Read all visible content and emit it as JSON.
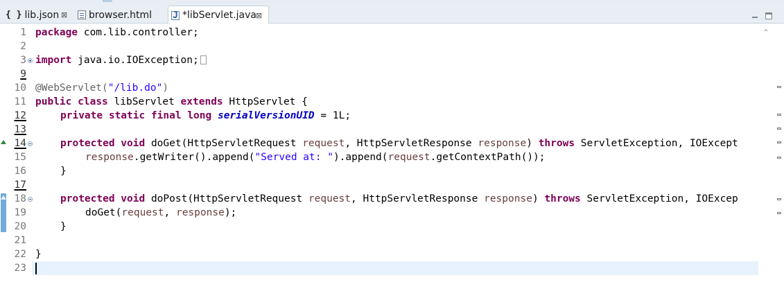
{
  "tabs": [
    {
      "label": "lib.json",
      "icon": "json-file-icon",
      "icon_glyph": "{ }"
    },
    {
      "label": "browser.html",
      "icon": "html-file-icon"
    },
    {
      "label": "*libServlet.java",
      "icon": "java-file-icon",
      "icon_glyph": "J",
      "active": true
    }
  ],
  "close_glyph": "⊠",
  "scroll_up_glyph": "⌃",
  "gutter": {
    "line_numbers": [
      "1",
      "2",
      "3",
      "9",
      "10",
      "11",
      "12",
      "13",
      "14",
      "15",
      "16",
      "17",
      "18",
      "19",
      "20",
      "21",
      "22",
      "23"
    ]
  },
  "code": {
    "line1_kw": "package",
    "line1_rest": " com.lib.controller;",
    "line3_kw": "import",
    "line3_rest": " java.io.IOException;",
    "line10_ann": "@WebServlet(",
    "line10_str": "\"/lib.do\"",
    "line10_end": ")",
    "line11_kw1": "public",
    "line11_kw2": "class",
    "line11_name": " libServlet ",
    "line11_kw3": "extends",
    "line11_rest": " HttpServlet {",
    "line12_kw": "private static final long",
    "line12_field": "serialVersionUID",
    "line12_rest": " = 1L;",
    "line14_kw1": "protected void",
    "line14_mid1": " doGet(HttpServletRequest ",
    "line14_p1": "request",
    "line14_mid2": ", HttpServletResponse ",
    "line14_p2": "response",
    "line14_mid3": ") ",
    "line14_kw2": "throws",
    "line14_rest": " ServletException, IOExcept",
    "line15_p1": "response",
    "line15_mid1": ".getWriter().append(",
    "line15_str": "\"Served at: \"",
    "line15_mid2": ").append(",
    "line15_p2": "request",
    "line15_rest": ".getContextPath());",
    "line16": "}",
    "line18_kw1": "protected void",
    "line18_mid1": " doPost(HttpServletRequest ",
    "line18_p1": "request",
    "line18_mid2": ", HttpServletResponse ",
    "line18_p2": "response",
    "line18_mid3": ") ",
    "line18_kw2": "throws",
    "line18_rest": " ServletException, IOExcep",
    "line19_call": "doGet(",
    "line19_p1": "request",
    "line19_mid": ", ",
    "line19_p2": "response",
    "line19_end": ");",
    "line20": "}",
    "line22": "}"
  },
  "colors": {
    "keyword": "#7f0055",
    "string": "#2a00ff",
    "annotation": "#646464",
    "field": "#0000c0",
    "parameter": "#6a3e3e",
    "current_line": "#e8f2fe"
  }
}
